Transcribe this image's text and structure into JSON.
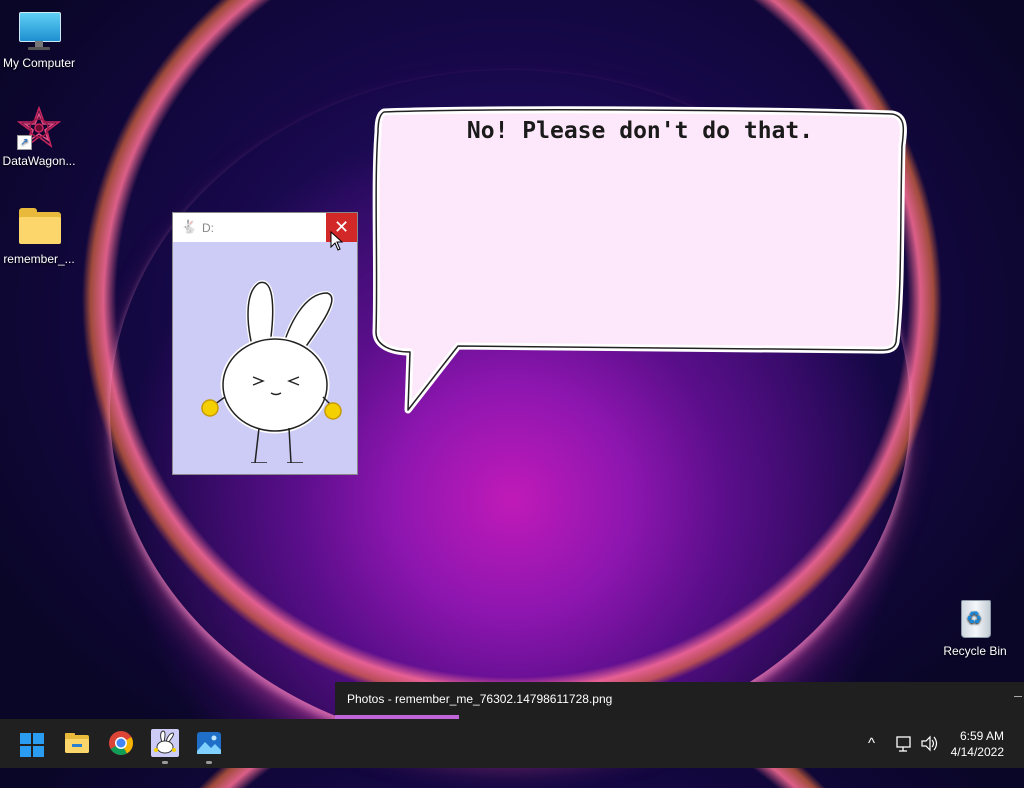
{
  "desktop": {
    "icons": [
      {
        "label": "My Computer",
        "icon": "computer-icon"
      },
      {
        "label": "DataWagon...",
        "icon": "star-shortcut-icon"
      },
      {
        "label": "remember_...",
        "icon": "folder-icon"
      },
      {
        "label": "Recycle Bin",
        "icon": "recycle-bin-icon"
      }
    ]
  },
  "app_window": {
    "title": "D:",
    "close_glyph": "✕"
  },
  "speech_bubble": {
    "text": "No! Please don't do that."
  },
  "notification": {
    "text": "Photos - remember_me_76302.14798611728.png",
    "progress": 0.18
  },
  "taskbar": {
    "apps": [
      "start-icon",
      "file-explorer-icon",
      "chrome-icon",
      "bunny-app-icon",
      "photos-icon"
    ],
    "tray": {
      "chevron": "^",
      "time": "6:59 AM",
      "date": "4/14/2022"
    }
  },
  "colors": {
    "close_red": "#d22828",
    "bubble_fill": "#fde8fb",
    "window_bg": "#ccccf6",
    "taskbar": "#202020",
    "progress": "#c065d8"
  }
}
